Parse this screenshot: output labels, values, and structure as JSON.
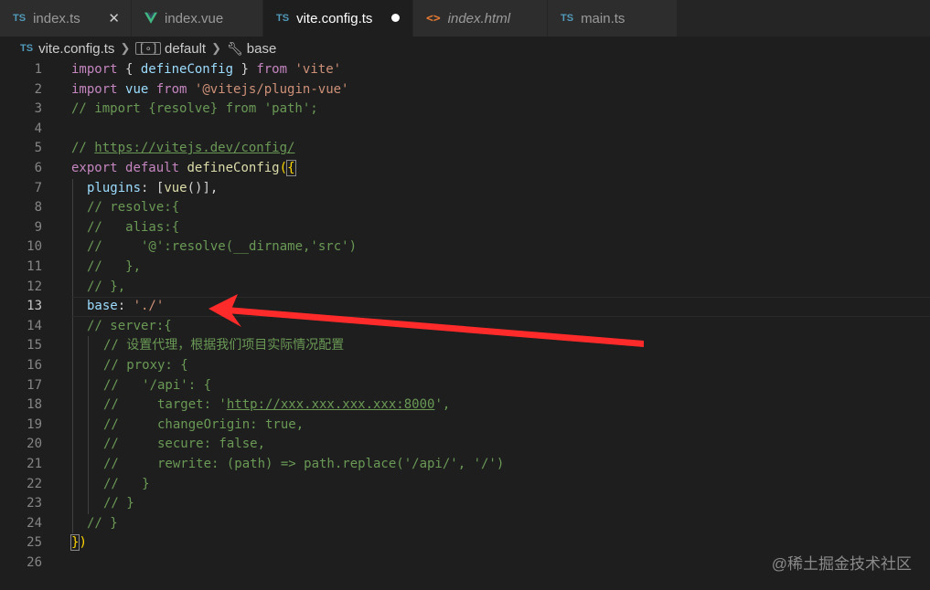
{
  "tabs": [
    {
      "label": "index.ts",
      "icon": "TS",
      "icon_name": "typescript-icon",
      "active": false,
      "has_close": true
    },
    {
      "label": "index.vue",
      "icon": "vue",
      "icon_name": "vue-icon",
      "active": false
    },
    {
      "label": "vite.config.ts",
      "icon": "TS",
      "icon_name": "typescript-icon",
      "active": true,
      "dirty": true
    },
    {
      "label": "index.html",
      "icon": "<>",
      "icon_name": "html-icon",
      "active": false
    },
    {
      "label": "main.ts",
      "icon": "TS",
      "icon_name": "typescript-icon",
      "active": false
    }
  ],
  "breadcrumb": {
    "file_icon": "TS",
    "file": "vite.config.ts",
    "symbol_icon": "[∘]",
    "symbol": "default",
    "property": "base"
  },
  "lines": {
    "1": {
      "num": "1",
      "t": [
        "import",
        " { ",
        "defineConfig",
        " } ",
        "from",
        " ",
        "'vite'"
      ]
    },
    "2": {
      "num": "2",
      "t": [
        "import",
        " ",
        "vue",
        " ",
        "from",
        " ",
        "'@vitejs/plugin-vue'"
      ]
    },
    "3": {
      "num": "3",
      "t": [
        "// import {resolve} from 'path';"
      ]
    },
    "4": {
      "num": "4"
    },
    "5": {
      "num": "5",
      "t": [
        "// ",
        "https://vitejs.dev/config/"
      ]
    },
    "6": {
      "num": "6",
      "t": [
        "export",
        " ",
        "default",
        " ",
        "defineConfig",
        "(",
        "{"
      ]
    },
    "7": {
      "num": "7",
      "t": [
        "plugins",
        ": [",
        "vue",
        "()],"
      ]
    },
    "8": {
      "num": "8",
      "t": [
        "// resolve:{"
      ]
    },
    "9": {
      "num": "9",
      "t": [
        "//   alias:{"
      ]
    },
    "10": {
      "num": "10",
      "t": [
        "//     '@':resolve(__dirname,'src')"
      ]
    },
    "11": {
      "num": "11",
      "t": [
        "//   },"
      ]
    },
    "12": {
      "num": "12",
      "t": [
        "// },"
      ]
    },
    "13": {
      "num": "13",
      "t": [
        "base",
        ": ",
        "'./'"
      ]
    },
    "14": {
      "num": "14",
      "t": [
        "// server:{"
      ]
    },
    "15": {
      "num": "15",
      "t": [
        "// 设置代理，根据我们项目实际情况配置"
      ]
    },
    "16": {
      "num": "16",
      "t": [
        "// proxy: {"
      ]
    },
    "17": {
      "num": "17",
      "t": [
        "//   '/api': {"
      ]
    },
    "18": {
      "num": "18",
      "t": [
        "//     target: '",
        "http://xxx.xxx.xxx.xxx:8000",
        "',"
      ]
    },
    "19": {
      "num": "19",
      "t": [
        "//     changeOrigin: true,"
      ]
    },
    "20": {
      "num": "20",
      "t": [
        "//     secure: false,"
      ]
    },
    "21": {
      "num": "21",
      "t": [
        "//     rewrite: (path) => path.replace('/api/', '/')"
      ]
    },
    "22": {
      "num": "22",
      "t": [
        "//   }"
      ]
    },
    "23": {
      "num": "23",
      "t": [
        "// }"
      ]
    },
    "24": {
      "num": "24",
      "t": [
        "// }"
      ]
    },
    "25": {
      "num": "25",
      "t": [
        "}",
        ")"
      ]
    },
    "26": {
      "num": "26"
    }
  },
  "annotation": {
    "color": "#ff2a2a",
    "target_line": 13
  },
  "watermark": "@稀土掘金技术社区",
  "colors": {
    "keyword": "#c586c0",
    "function": "#dcdcaa",
    "string": "#ce9178",
    "comment": "#6a9955",
    "property": "#9cdcfe",
    "bracket": "#ffd700"
  }
}
